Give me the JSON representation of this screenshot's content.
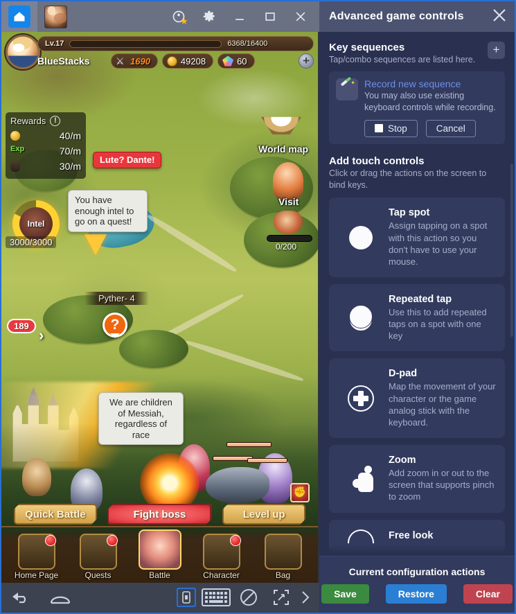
{
  "emulator": {
    "tabs": [
      {
        "name": "home-tab",
        "icon": "home-icon",
        "active": true
      },
      {
        "name": "game-tab",
        "icon": "game-avatar-icon",
        "active": false
      }
    ],
    "window_buttons": [
      {
        "label": "",
        "icon": "star-rating-icon"
      },
      {
        "label": "",
        "icon": "gear-icon"
      },
      {
        "label": "",
        "icon": "minimize-icon"
      },
      {
        "label": "",
        "icon": "maximize-icon"
      },
      {
        "label": "",
        "icon": "close-icon"
      }
    ],
    "bottom_bar": [
      {
        "icon": "back-arrow-icon"
      },
      {
        "icon": "home-outline-icon"
      },
      {
        "icon": "screenshot-icon"
      },
      {
        "icon": "keyboard-icon"
      },
      {
        "icon": "no-ads-icon"
      },
      {
        "icon": "fullscreen-icon"
      },
      {
        "icon": "chevron-right-icon"
      }
    ]
  },
  "game": {
    "hud": {
      "level": "Lv.17",
      "xp": "6368/16400",
      "xp_percent": 39,
      "player_name": "BlueStacks",
      "attack": "1690",
      "gold": "49208",
      "gems": "60",
      "plus": "+"
    },
    "rewards": {
      "title": "Rewards",
      "info": "!",
      "rows": [
        {
          "icon": "coin-icon",
          "label": "",
          "value": "40/m"
        },
        {
          "icon": "exp-icon",
          "label": "Exp",
          "value": "70/m"
        },
        {
          "icon": "potion-icon",
          "label": "",
          "value": "30/m"
        }
      ]
    },
    "intel": {
      "label": "Intel",
      "count": "3000/3000"
    },
    "bubbles": {
      "npc_red": "Lute? Dante!",
      "quest_hint": "You have enough intel to go on a quest!",
      "dialogue": "We are children of Messiah, regardless of race"
    },
    "map_labels": {
      "world_map": "World map",
      "visit": "Visit",
      "monster_progress": "0/200",
      "nameplate": "Pyther- 4",
      "quest_marker": "?",
      "chat_badge": "189",
      "chevron": "›"
    },
    "action_buttons": [
      {
        "label": "Quick Battle",
        "style": "gold"
      },
      {
        "label": "Fight boss",
        "style": "red"
      },
      {
        "label": "Level up",
        "style": "gold"
      }
    ],
    "nav_items": [
      {
        "label": "Home Page",
        "badge": true
      },
      {
        "label": "Quests",
        "badge": true
      },
      {
        "label": "Battle",
        "badge": false
      },
      {
        "label": "Character",
        "badge": true
      },
      {
        "label": "Bag",
        "badge": false
      }
    ]
  },
  "panel": {
    "title": "Advanced game controls",
    "close_icon": "close-icon",
    "key_sequences": {
      "title": "Key sequences",
      "subtitle": "Tap/combo sequences are listed here.",
      "add_label": "+",
      "record": {
        "link": "Record new sequence",
        "description": "You may also use existing keyboard controls while recording.",
        "stop_label": "Stop",
        "cancel_label": "Cancel"
      }
    },
    "touch_controls": {
      "title": "Add touch controls",
      "subtitle": "Click or drag the actions on the screen to bind keys.",
      "cards": [
        {
          "icon": "tap-spot-icon",
          "title": "Tap spot",
          "desc": "Assign tapping on a spot with this action so you don't have to use your mouse."
        },
        {
          "icon": "repeated-tap-icon",
          "title": "Repeated tap",
          "desc": "Use this to add repeated taps on a spot with one key"
        },
        {
          "icon": "d-pad-icon",
          "title": "D-pad",
          "desc": "Map the movement of your character or the game analog stick with the keyboard."
        },
        {
          "icon": "zoom-pinch-icon",
          "title": "Zoom",
          "desc": "Add zoom in or out to the screen that supports pinch to zoom"
        },
        {
          "icon": "free-look-icon",
          "title": "Free look",
          "desc": ""
        }
      ]
    },
    "footer": {
      "title": "Current configuration actions",
      "save_label": "Save",
      "restore_label": "Restore",
      "clear_label": "Clear"
    }
  },
  "colors": {
    "accent_blue": "#2a6fd4",
    "panel_bg": "#2a3050",
    "panel_header": "#4b5371",
    "card_bg": "#323a5e",
    "save_green": "#3a8a3f",
    "restore_blue": "#2a7fd4",
    "clear_red": "#c0444f",
    "link_blue": "#6f8fe8"
  }
}
